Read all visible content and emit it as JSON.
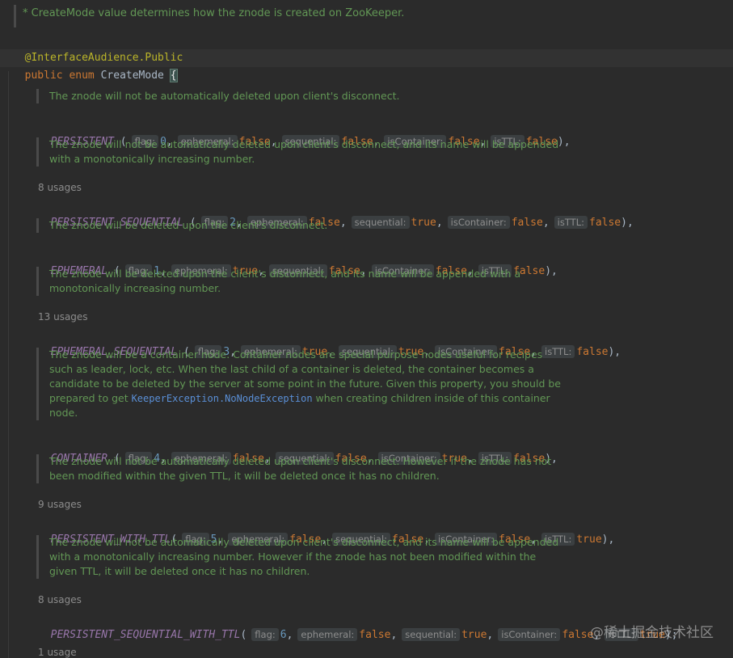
{
  "header": {
    "top_doc": "* CreateMode value determines how the znode is created on ZooKeeper.",
    "annotation": "@InterfaceAudience.Public",
    "kw_public": "public",
    "kw_enum": "enum",
    "enum_name": "CreateMode",
    "open_brace": "{"
  },
  "hints": {
    "flag": "flag:",
    "ephemeral": "ephemeral:",
    "sequential": "sequential:",
    "isContainer": "isContainer:",
    "isTTL": "isTTL:"
  },
  "constants": [
    {
      "doc": [
        "The znode will not be automatically deleted upon client's disconnect."
      ],
      "usages": "",
      "name": "PERSISTENT",
      "sep": " (",
      "flag": "0",
      "ephemeral": "false",
      "sequential": "false",
      "isContainer": "false",
      "isTTL": "false",
      "end": "),"
    },
    {
      "doc": [
        "The znode will not be automatically deleted upon client's disconnect, and its name will be appended",
        "with a monotonically increasing number."
      ],
      "usages": "8 usages",
      "name": "PERSISTENT_SEQUENTIAL",
      "sep": " (",
      "flag": "2",
      "ephemeral": "false",
      "sequential": "true",
      "isContainer": "false",
      "isTTL": "false",
      "end": "),"
    },
    {
      "doc": [
        "The znode will be deleted upon the client's disconnect."
      ],
      "usages": "",
      "name": "EPHEMERAL",
      "sep": " (",
      "flag": "1",
      "ephemeral": "true",
      "sequential": "false",
      "isContainer": "false",
      "isTTL": "false",
      "end": "),"
    },
    {
      "doc": [
        "The znode will be deleted upon the client's disconnect, and its name will be appended with a",
        "monotonically increasing number."
      ],
      "usages": "13 usages",
      "name": "EPHEMERAL_SEQUENTIAL",
      "sep": " (",
      "flag": "3",
      "ephemeral": "true",
      "sequential": "true",
      "isContainer": "false",
      "isTTL": "false",
      "end": "),"
    },
    {
      "doc": [
        "The znode will be a container node. Container nodes are special purpose nodes useful for recipes",
        "such as leader, lock, etc. When the last child of a container is deleted, the container becomes a",
        "candidate to be deleted by the server at some point in the future. Given this property, you should be"
      ],
      "doc_link_prefix": "prepared to get ",
      "doc_link": "KeeperException.NoNodeException",
      "doc_link_suffix": " when creating children inside of this container",
      "doc_last": "node.",
      "usages": "",
      "name": "CONTAINER",
      "sep": " (",
      "flag": "4",
      "ephemeral": "false",
      "sequential": "false",
      "isContainer": "true",
      "isTTL": "false",
      "end": "),"
    },
    {
      "doc": [
        "The znode will not be automatically deleted upon client's disconnect. However if the znode has not",
        "been modified within the given TTL, it will be deleted once it has no children."
      ],
      "usages": "9 usages",
      "name": "PERSISTENT_WITH_TTL",
      "sep": "(",
      "flag": "5",
      "ephemeral": "false",
      "sequential": "false",
      "isContainer": "false",
      "isTTL": "true",
      "end": "),"
    },
    {
      "doc": [
        "The znode will not be automatically deleted upon client's disconnect, and its name will be appended",
        "with a monotonically increasing number. However if the znode has not been modified within the",
        "given TTL, it will be deleted once it has no children."
      ],
      "usages": "8 usages",
      "name": "PERSISTENT_SEQUENTIAL_WITH_TTL",
      "sep": "(",
      "flag": "6",
      "ephemeral": "false",
      "sequential": "true",
      "isContainer": "false",
      "isTTL": "true",
      "end": ");"
    }
  ],
  "footer": {
    "usages": "1 usage"
  },
  "watermark": "@稀土掘金技术社区",
  "colors": {
    "background": "#2b2b2b",
    "doc_comment": "#629755",
    "keyword": "#cc7832",
    "constant": "#9876aa",
    "number": "#6897bb",
    "annotation": "#bbb529"
  }
}
